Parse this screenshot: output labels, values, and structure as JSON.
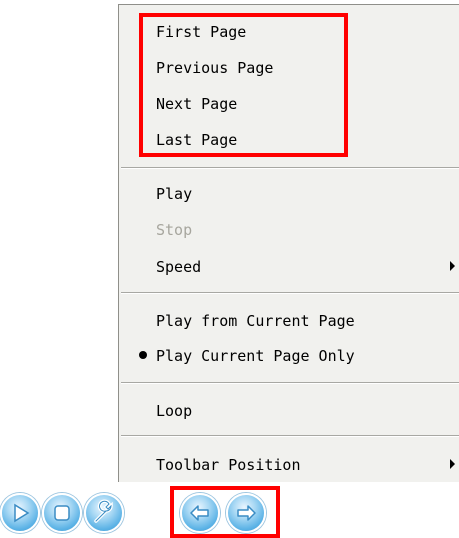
{
  "menu": {
    "groups": [
      {
        "items": [
          {
            "label": "First Page"
          },
          {
            "label": "Previous Page"
          },
          {
            "label": "Next Page"
          },
          {
            "label": "Last Page"
          }
        ]
      },
      {
        "items": [
          {
            "label": "Play"
          },
          {
            "label": "Stop",
            "disabled": true
          },
          {
            "label": "Speed",
            "has_submenu": true
          }
        ]
      },
      {
        "items": [
          {
            "label": "Play from Current Page"
          },
          {
            "label": "Play Current Page Only",
            "selected": true
          }
        ]
      },
      {
        "items": [
          {
            "label": "Loop"
          }
        ]
      },
      {
        "items": [
          {
            "label": "Toolbar Position",
            "has_submenu": true
          }
        ]
      }
    ]
  },
  "toolbar": {
    "buttons": [
      {
        "icon": "play-icon"
      },
      {
        "icon": "stop-icon"
      },
      {
        "icon": "wrench-icon"
      },
      {
        "icon": "previous-page-icon"
      },
      {
        "icon": "next-page-icon"
      }
    ]
  },
  "colors": {
    "highlight": "#ff0000",
    "menu_background": "#f1f1ee",
    "disabled_text": "#a7a69e",
    "button_blue": "#5cb3e6"
  }
}
